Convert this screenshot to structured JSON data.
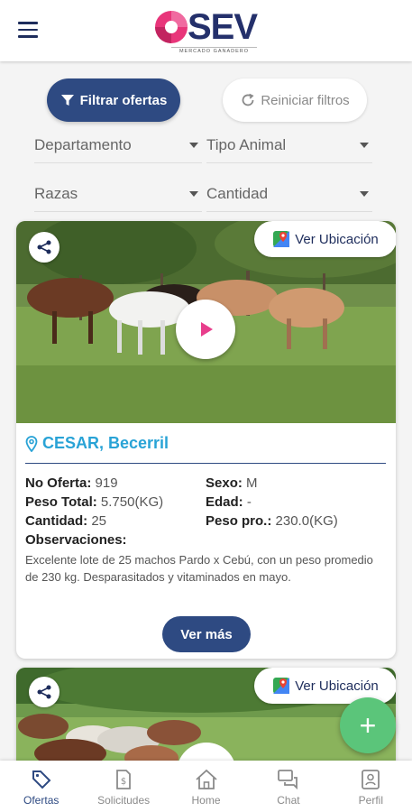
{
  "app": {
    "logo_text": "SEV",
    "logo_subtitle": "MERCADO GANADERO"
  },
  "filters": {
    "filter_label": "Filtrar ofertas",
    "reset_label": "Reiniciar filtros",
    "departamento": "Departamento",
    "tipo_animal": "Tipo Animal",
    "razas": "Razas",
    "cantidad": "Cantidad"
  },
  "offers": [
    {
      "location_label": "Ver Ubicación",
      "place": "CESAR, Becerril",
      "no_oferta_label": "No Oferta:",
      "no_oferta": "919",
      "sexo_label": "Sexo:",
      "sexo": "M",
      "peso_total_label": "Peso Total:",
      "peso_total": "5.750(KG)",
      "edad_label": "Edad:",
      "edad": "-",
      "cantidad_label": "Cantidad:",
      "cantidad": "25",
      "peso_pro_label": "Peso pro.:",
      "peso_pro": "230.0(KG)",
      "observaciones_label": "Observaciones:",
      "observaciones": "Excelente lote de 25 machos Pardo x Cebú, con un peso promedio de 230 kg. Desparasitados y vitaminados en mayo.",
      "ver_mas": "Ver más"
    },
    {
      "location_label": "Ver Ubicación"
    }
  ],
  "fab": {
    "icon": "plus-icon",
    "label": "+"
  },
  "nav": [
    {
      "label": "Ofertas",
      "icon": "tag-icon",
      "active": true
    },
    {
      "label": "Solicitudes",
      "icon": "document-dollar-icon",
      "active": false
    },
    {
      "label": "Home",
      "icon": "home-icon",
      "active": false
    },
    {
      "label": "Chat",
      "icon": "chat-icon",
      "active": false
    },
    {
      "label": "Perfil",
      "icon": "profile-icon",
      "active": false
    }
  ],
  "colors": {
    "primary": "#2e4a82",
    "accent_location": "#29a3d6",
    "fab": "#5bc57a",
    "play": "#e83e8c"
  }
}
